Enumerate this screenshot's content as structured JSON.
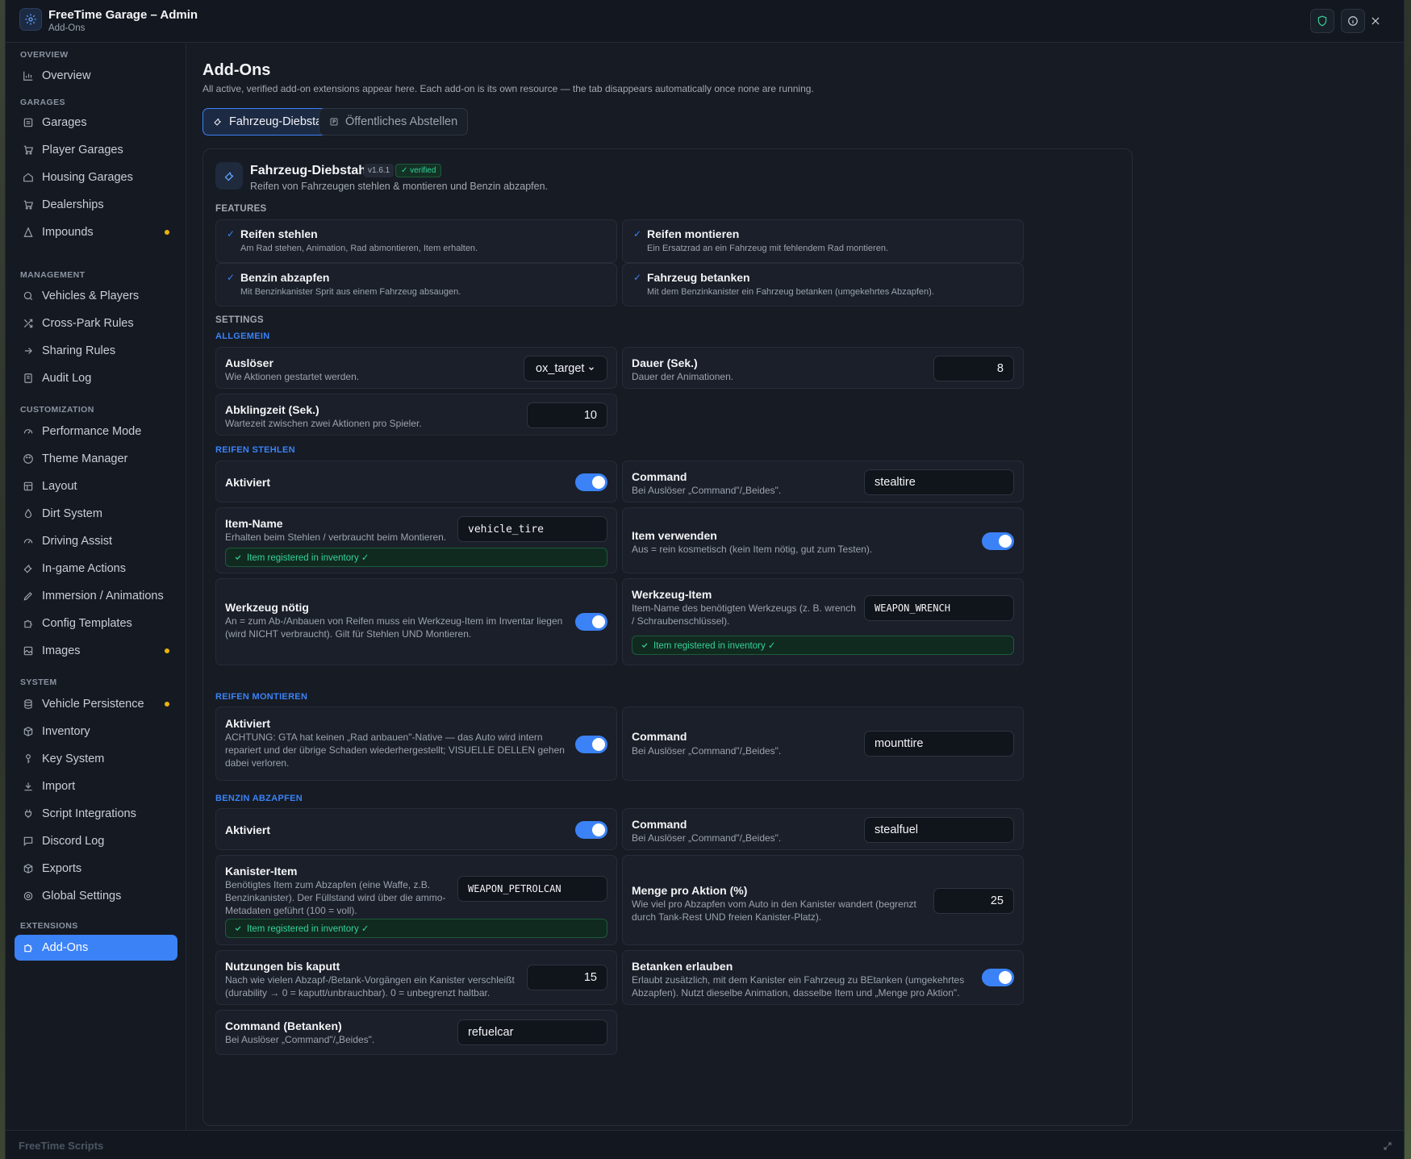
{
  "window": {
    "title": "FreeTime Garage – Admin",
    "subtitle": "Add-Ons"
  },
  "sidebar": {
    "sections": {
      "overview": "OVERVIEW",
      "garages": "GARAGES",
      "management": "MANAGEMENT",
      "customization": "CUSTOMIZATION",
      "system": "SYSTEM",
      "extensions": "EXTENSIONS"
    },
    "items": {
      "overview": "Overview",
      "garages": "Garages",
      "player_garages": "Player Garages",
      "housing_garages": "Housing Garages",
      "dealerships": "Dealerships",
      "impounds": "Impounds",
      "vehicles_players": "Vehicles & Players",
      "cross_park": "Cross-Park Rules",
      "sharing": "Sharing Rules",
      "audit": "Audit Log",
      "performance": "Performance Mode",
      "theme": "Theme Manager",
      "layout": "Layout",
      "dirt": "Dirt System",
      "driving": "Driving Assist",
      "ingame": "In-game Actions",
      "immersion": "Immersion / Animations",
      "config_templates": "Config Templates",
      "images": "Images",
      "persistence": "Vehicle Persistence",
      "inventory": "Inventory",
      "keys": "Key System",
      "import": "Import",
      "script_int": "Script Integrations",
      "discord": "Discord Log",
      "exports": "Exports",
      "global": "Global Settings",
      "addons": "Add-Ons"
    },
    "status_dot_color": "#eab308"
  },
  "footer": {
    "brand": "FreeTime Scripts"
  },
  "main": {
    "title": "Add-Ons",
    "description": "All active, verified add-on extensions appear here. Each add-on is its own resource — the tab disappears automatically once none are running.",
    "tabs": [
      "Fahrzeug-Diebstahl",
      "Öffentliches Abstellen"
    ],
    "addon": {
      "name": "Fahrzeug-Diebstahl",
      "version": "v1.6.1",
      "verified": "verified",
      "subtitle": "Reifen von Fahrzeugen stehlen & montieren und Benzin abzapfen.",
      "features_label": "FEATURES",
      "features": [
        {
          "title": "Reifen stehlen",
          "desc": "Am Rad stehen, Animation, Rad abmontieren, Item erhalten."
        },
        {
          "title": "Reifen montieren",
          "desc": "Ein Ersatzrad an ein Fahrzeug mit fehlendem Rad montieren."
        },
        {
          "title": "Benzin abzapfen",
          "desc": "Mit Benzinkanister Sprit aus einem Fahrzeug absaugen."
        },
        {
          "title": "Fahrzeug betanken",
          "desc": "Mit dem Benzinkanister ein Fahrzeug betanken (umgekehrtes Abzapfen)."
        }
      ],
      "settings_label": "SETTINGS",
      "groups": {
        "general": "ALLGEMEIN",
        "steal": "REIFEN STEHLEN",
        "mount": "REIFEN MONTIEREN",
        "fuel": "BENZIN ABZAPFEN"
      },
      "registered": "Item registered in inventory ✓",
      "cmd_desc": "Bei Auslöser „Command\"/„Beides\".",
      "general": {
        "trigger": {
          "title": "Auslöser",
          "desc": "Wie Aktionen gestartet werden.",
          "value": "ox_target"
        },
        "duration": {
          "title": "Dauer (Sek.)",
          "desc": "Dauer der Animationen.",
          "value": "8"
        },
        "cooldown": {
          "title": "Abklingzeit (Sek.)",
          "desc": "Wartezeit zwischen zwei Aktionen pro Spieler.",
          "value": "10"
        }
      },
      "steal": {
        "enabled": {
          "title": "Aktiviert",
          "on": true
        },
        "command": {
          "title": "Command",
          "value": "stealtire"
        },
        "item": {
          "title": "Item-Name",
          "desc": "Erhalten beim Stehlen / verbraucht beim Montieren.",
          "value": "vehicle_tire"
        },
        "use_item": {
          "title": "Item verwenden",
          "desc": "Aus = rein kosmetisch (kein Item nötig, gut zum Testen).",
          "on": true
        },
        "tool": {
          "title": "Werkzeug nötig",
          "desc": "An = zum Ab-/Anbauen von Reifen muss ein Werkzeug-Item im Inventar liegen (wird NICHT verbraucht). Gilt für Stehlen UND Montieren.",
          "on": true
        },
        "tool_item": {
          "title": "Werkzeug-Item",
          "desc": "Item-Name des benötigten Werkzeugs (z. B. wrench / Schraubenschlüssel).",
          "value": "WEAPON_WRENCH"
        }
      },
      "mount": {
        "enabled": {
          "title": "Aktiviert",
          "desc": "ACHTUNG: GTA hat keinen „Rad anbauen\"-Native — das Auto wird intern repariert und der übrige Schaden wiederhergestellt; VISUELLE DELLEN gehen dabei verloren.",
          "on": true
        },
        "command": {
          "title": "Command",
          "value": "mounttire"
        }
      },
      "fuel": {
        "enabled": {
          "title": "Aktiviert",
          "on": true
        },
        "command": {
          "title": "Command",
          "value": "stealfuel"
        },
        "can": {
          "title": "Kanister-Item",
          "desc": "Benötigtes Item zum Abzapfen (eine Waffe, z.B. Benzinkanister). Der Füllstand wird über die ammo-Metadaten geführt (100 = voll).",
          "value": "WEAPON_PETROLCAN"
        },
        "amount": {
          "title": "Menge pro Aktion (%)",
          "desc": "Wie viel pro Abzapfen vom Auto in den Kanister wandert (begrenzt durch Tank-Rest UND freien Kanister-Platz).",
          "value": "25"
        },
        "uses": {
          "title": "Nutzungen bis kaputt",
          "desc": "Nach wie vielen Abzapf-/Betank-Vorgängen ein Kanister verschleißt (durability → 0 = kaputt/unbrauchbar). 0 = unbegrenzt haltbar.",
          "value": "15"
        },
        "refuel": {
          "title": "Betanken erlauben",
          "desc": "Erlaubt zusätzlich, mit dem Kanister ein Fahrzeug zu BEtanken (umgekehrtes Abzapfen). Nutzt dieselbe Animation, dasselbe Item und „Menge pro Aktion\".",
          "on": true
        },
        "refuel_cmd": {
          "title": "Command (Betanken)",
          "value": "refuelcar"
        }
      }
    }
  },
  "colors": {
    "accent": "#3b82f6",
    "success": "#34d399",
    "panel": "#161b24"
  }
}
